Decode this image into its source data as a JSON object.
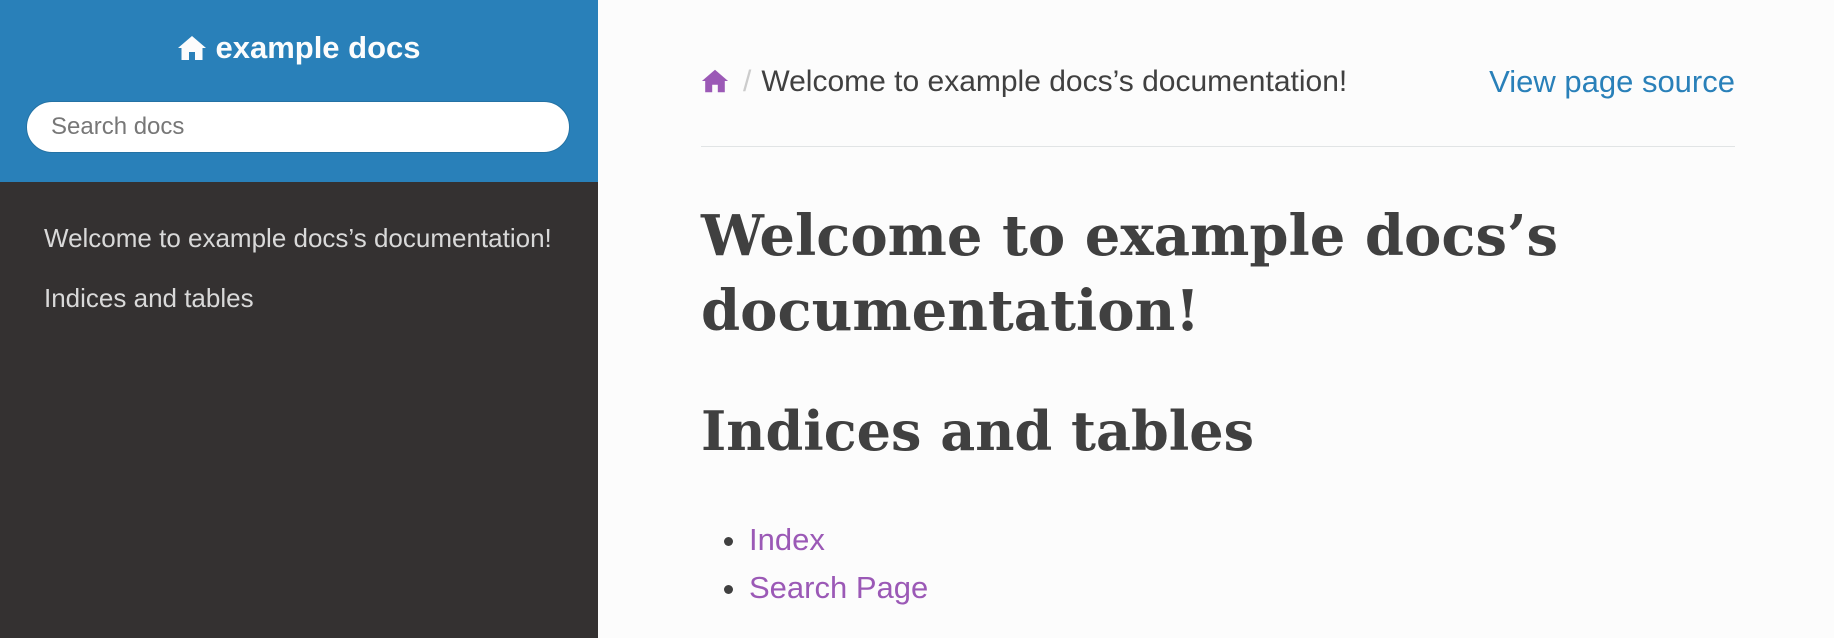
{
  "sidebar": {
    "brand": "example docs",
    "search": {
      "placeholder": "Search docs",
      "value": ""
    },
    "items": [
      {
        "label": "Welcome to example docs’s documentation!"
      },
      {
        "label": "Indices and tables"
      }
    ]
  },
  "breadcrumb": {
    "home_icon": "home-icon",
    "separator": "/",
    "current": "Welcome to example docs’s documentation!",
    "view_source": "View page source"
  },
  "content": {
    "title": "Welcome to example docs’s documentation!",
    "section_title": "Indices and tables",
    "links": [
      {
        "label": "Index"
      },
      {
        "label": "Search Page"
      }
    ]
  },
  "colors": {
    "sidebar_top": "#2980b9",
    "sidebar_bg": "#343131",
    "link_visited": "#9b59b6",
    "link": "#2980b9",
    "text": "#404040"
  }
}
